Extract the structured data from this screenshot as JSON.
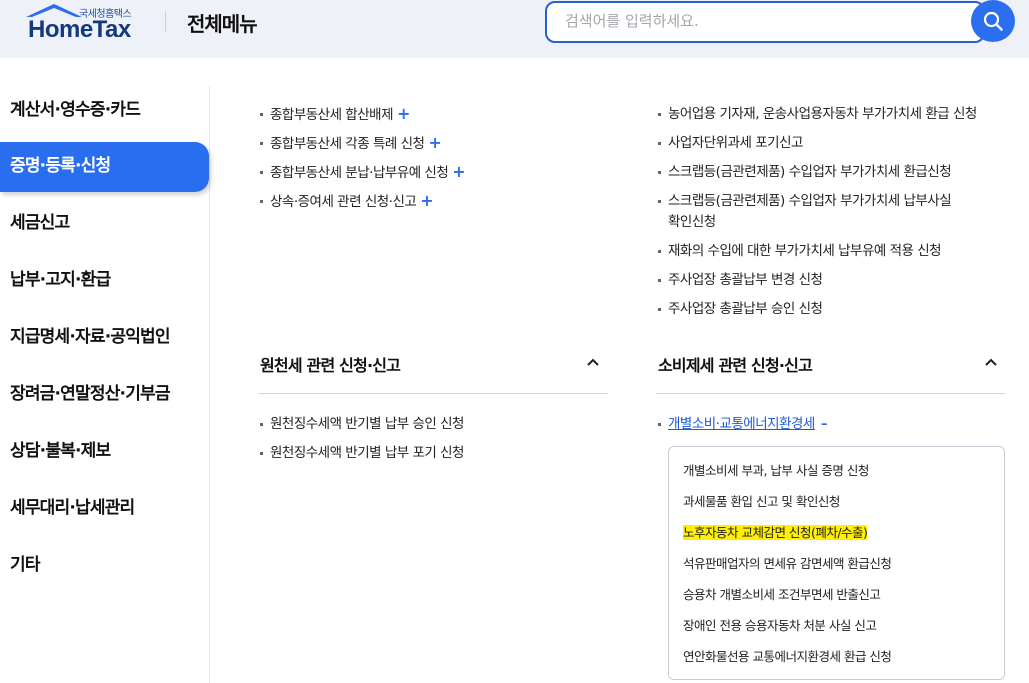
{
  "header": {
    "logo_sub": "국세청홈택스",
    "logo_main": "HomeTax",
    "title": "전체메뉴",
    "search_placeholder": "검색어를 입력하세요."
  },
  "sidebar": {
    "items": [
      {
        "label": "계산서·영수증·카드"
      },
      {
        "label": "증명·등록·신청",
        "active": true
      },
      {
        "label": "세금신고"
      },
      {
        "label": "납부·고지·환급"
      },
      {
        "label": "지급명세·자료·공익법인"
      },
      {
        "label": "장려금·연말정산·기부금"
      },
      {
        "label": "상담·불복·제보"
      },
      {
        "label": "세무대리·납세관리"
      },
      {
        "label": "기타"
      }
    ]
  },
  "left_top_list": [
    {
      "label": "종합부동산세 합산배제",
      "expand": "+"
    },
    {
      "label": "종합부동산세 각종 특례 신청",
      "expand": "+"
    },
    {
      "label": "종합부동산세 분납·납부유예 신청",
      "expand": "+"
    },
    {
      "label": "상속·증여세 관련 신청·신고",
      "expand": "+"
    }
  ],
  "right_top_list": [
    {
      "label": "농어업용 기자재, 운송사업용자동차 부가가치세 환급 신청"
    },
    {
      "label": "사업자단위과세 포기신고"
    },
    {
      "label": "스크랩등(금관련제품) 수입업자 부가가치세 환급신청"
    },
    {
      "label_line1": "스크랩등(금관련제품) 수입업자 부가가치세 납부사실",
      "label_line2": "확인신청"
    },
    {
      "label": "재화의 수입에 대한 부가가치세 납부유예 적용 신청"
    },
    {
      "label": "주사업장 총괄납부 변경 신청"
    },
    {
      "label": "주사업장 총괄납부 승인 신청"
    }
  ],
  "withholding_section": {
    "title": "원천세 관련 신청·신고",
    "items": [
      {
        "label": "원천징수세액 반기별 납부 승인 신청"
      },
      {
        "label": "원천징수세액 반기별 납부 포기 신청"
      }
    ]
  },
  "consumption_section": {
    "title": "소비제세 관련 신청·신고",
    "expanded_item": {
      "label": "개별소비·교통에너지환경세",
      "collapse": "–"
    },
    "sub_items": [
      {
        "label": "개별소비세 부과, 납부 사실 증명 신청"
      },
      {
        "label": "과세물품 환입 신고 및 확인신청"
      },
      {
        "label": "노후자동차 교체감면 신청(폐차/수출)",
        "highlighted": true
      },
      {
        "label": "석유판매업자의 면세유 감면세액 환급신청"
      },
      {
        "label": "승용차 개별소비세 조건부면세 반출신고"
      },
      {
        "label": "장애인 전용 승용자동차 처분 사실 신고"
      },
      {
        "label": "연안화물선용 교통에너지환경세 환급 신청"
      }
    ]
  },
  "colors": {
    "accent": "#2a6ef0",
    "header_bg": "#eef1f8",
    "highlight": "#ffef00"
  }
}
